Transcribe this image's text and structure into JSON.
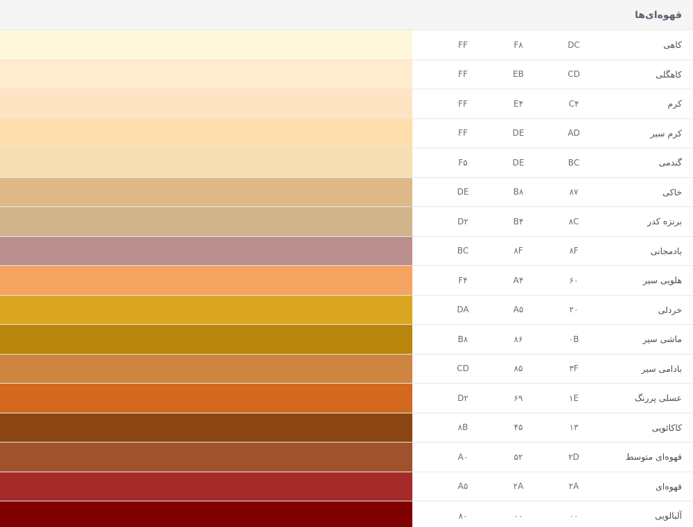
{
  "header": {
    "title": "قهوه‌ای‌ها"
  },
  "colors": [
    {
      "name": "کاهی",
      "r": "DC",
      "g": "F۸",
      "b": "FF",
      "swatch": "#FFF8DC"
    },
    {
      "name": "کاهگلی",
      "r": "CD",
      "g": "EB",
      "b": "FF",
      "swatch": "#FFEBCD"
    },
    {
      "name": "کرم",
      "r": "C۴",
      "g": "E۴",
      "b": "FF",
      "swatch": "#FFE4C4"
    },
    {
      "name": "کرم سیر",
      "r": "AD",
      "g": "DE",
      "b": "FF",
      "swatch": "#FFDEAD"
    },
    {
      "name": "گندمی",
      "r": "BC",
      "g": "DE",
      "b": "F۵",
      "swatch": "#F5DEB3"
    },
    {
      "name": "خاکی",
      "r": "۸۷",
      "g": "B۸",
      "b": "DE",
      "swatch": "#DEB887"
    },
    {
      "name": "برنزه کدر",
      "r": "۸C",
      "g": "B۴",
      "b": "D۲",
      "swatch": "#D2B48C"
    },
    {
      "name": "بادمجانی",
      "r": "۸F",
      "g": "۸F",
      "b": "BC",
      "swatch": "#BC8F8F"
    },
    {
      "name": "هلویی سیر",
      "r": "۶۰",
      "g": "A۴",
      "b": "F۴",
      "swatch": "#F4A460"
    },
    {
      "name": "خردلی",
      "r": "۲۰",
      "g": "A۵",
      "b": "DA",
      "swatch": "#DAA520"
    },
    {
      "name": "ماشی سیر",
      "r": "۰B",
      "g": "۸۶",
      "b": "B۸",
      "swatch": "#B8860B"
    },
    {
      "name": "بادامی سیر",
      "r": "۳F",
      "g": "۸۵",
      "b": "CD",
      "swatch": "#CD853F"
    },
    {
      "name": "عسلی پررنگ",
      "r": "۱E",
      "g": "۶۹",
      "b": "D۲",
      "swatch": "#D2691E"
    },
    {
      "name": "کاکائویی",
      "r": "۱۳",
      "g": "۴۵",
      "b": "۸B",
      "swatch": "#8B4513"
    },
    {
      "name": "قهوه‌ای متوسط",
      "r": "۲D",
      "g": "۵۲",
      "b": "A۰",
      "swatch": "#A0522D"
    },
    {
      "name": "قهوه‌ای",
      "r": "۲A",
      "g": "۲A",
      "b": "A۵",
      "swatch": "#A52A2A"
    },
    {
      "name": "آلبالویی",
      "r": "۰۰",
      "g": "۰۰",
      "b": "۸۰",
      "swatch": "#800000"
    }
  ]
}
